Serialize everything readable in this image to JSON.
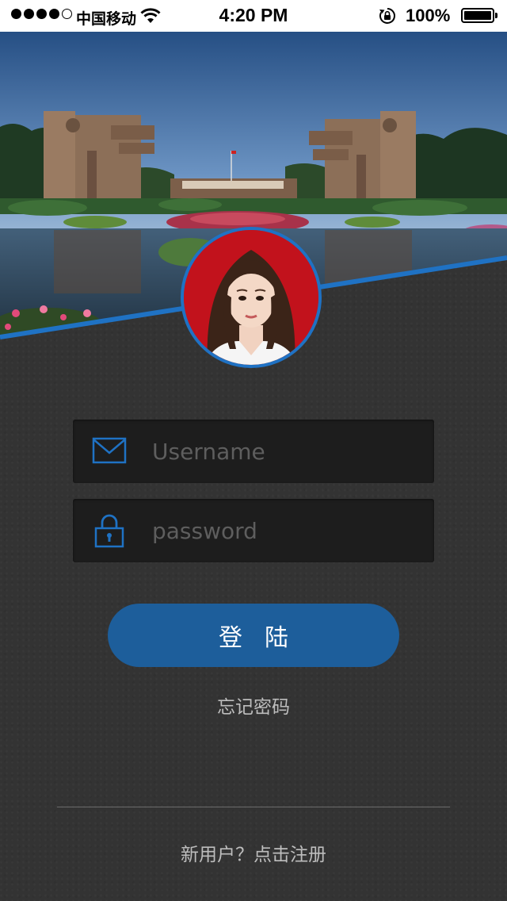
{
  "status_bar": {
    "carrier": "中国移动",
    "time": "4:20 PM",
    "battery_percent": "100%",
    "icons": [
      "signal-dots-icon",
      "wifi-icon",
      "rotation-lock-icon",
      "battery-icon"
    ]
  },
  "login_form": {
    "username_placeholder": "Username",
    "username_value": "",
    "password_placeholder": "password",
    "password_value": "",
    "username_icon": "envelope-icon",
    "password_icon": "padlock-icon",
    "login_button_label": "登陆",
    "forgot_password_label": "忘记密码",
    "register_label": "新用户？点击注册"
  },
  "colors": {
    "accent": "#1f72c4",
    "button": "#1d5e9b",
    "background": "#333333",
    "field": "#1d1d1d"
  }
}
